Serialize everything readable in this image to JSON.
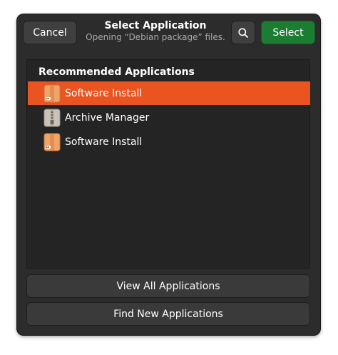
{
  "header": {
    "cancel_label": "Cancel",
    "title": "Select Application",
    "subtitle": "Opening “Debian package” files.",
    "search_icon": "search-icon",
    "select_label": "Select"
  },
  "list": {
    "heading": "Recommended Applications",
    "items": [
      {
        "label": "Software Install",
        "icon": "package-icon",
        "selected": true
      },
      {
        "label": "Archive Manager",
        "icon": "archive-icon",
        "selected": false
      },
      {
        "label": "Software Install",
        "icon": "package-icon",
        "selected": false
      }
    ]
  },
  "footer": {
    "view_all_label": "View All Applications",
    "find_new_label": "Find New Applications"
  },
  "colors": {
    "accent_selection": "#e95420",
    "suggested_action": "#1b7d32",
    "dialog_bg": "#2c2c2c"
  }
}
